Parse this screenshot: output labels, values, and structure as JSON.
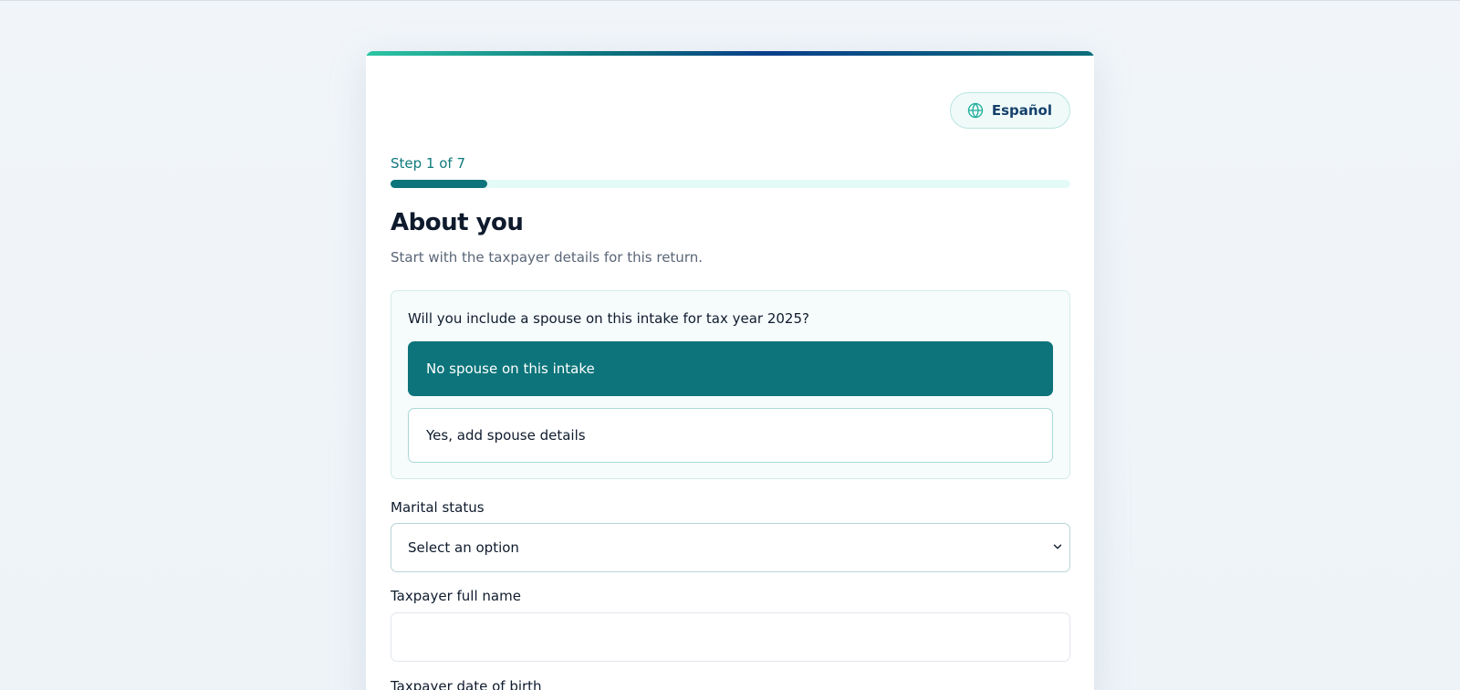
{
  "language_toggle": {
    "label": "Español",
    "icon": "globe-icon"
  },
  "progress": {
    "label": "Step 1 of 7",
    "current_step": 1,
    "total_steps": 7,
    "fraction": 0.142
  },
  "section": {
    "title": "About you",
    "subtitle": "Start with the taxpayer details for this return."
  },
  "spouse_question": {
    "question": "Will you include a spouse on this intake for tax year 2025?",
    "options": [
      {
        "label": "No spouse on this intake",
        "selected": true
      },
      {
        "label": "Yes, add spouse details",
        "selected": false
      }
    ]
  },
  "fields": {
    "marital_status": {
      "label": "Marital status",
      "value": "Select an option",
      "icon": "chevron-down-icon"
    },
    "taxpayer_full_name": {
      "label": "Taxpayer full name",
      "value": "",
      "placeholder": ""
    },
    "taxpayer_dob": {
      "label": "Taxpayer date of birth"
    }
  },
  "colors": {
    "accent": "#0c747a",
    "progress_track": "#e3faf7",
    "step_text": "#0f7a7c",
    "language_text": "#15416b"
  }
}
